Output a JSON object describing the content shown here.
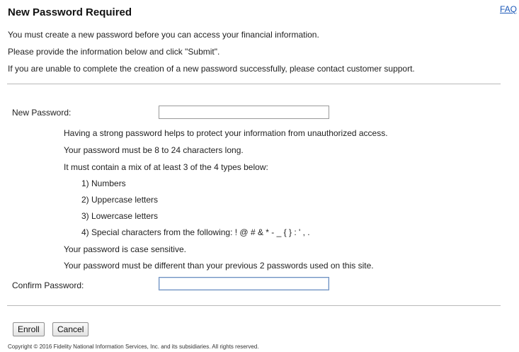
{
  "page": {
    "title": "New Password Required",
    "faq_link": "FAQ",
    "intro": [
      "You must create a new password before you can access your financial information.",
      "Please provide the information below and click \"Submit\".",
      "If you are unable to complete the creation of a new password successfully, please contact customer support."
    ]
  },
  "form": {
    "new_password_label": "New Password:",
    "new_password_value": "",
    "confirm_password_label": "Confirm Password:",
    "confirm_password_value": "",
    "requirements": {
      "strong": "Having a strong password helps to protect your information from unauthorized access.",
      "length": "Your password must be 8 to 24 characters long.",
      "mix": "It must contain a mix of at least 3 of the 4 types below:",
      "types": [
        "1) Numbers",
        "2) Uppercase letters",
        "3) Lowercase letters",
        "4) Special characters from the following:  !  @  #  &  *  -  _  {  }  :  '  ,  ."
      ],
      "case": "Your password is case sensitive.",
      "history": "Your password must be different than your previous 2 passwords used on this site."
    }
  },
  "buttons": {
    "enroll": "Enroll",
    "cancel": "Cancel"
  },
  "footer": {
    "copyright": "Copyright © 2016 Fidelity National Information Services, Inc. and its subsidiaries. All rights reserved."
  }
}
